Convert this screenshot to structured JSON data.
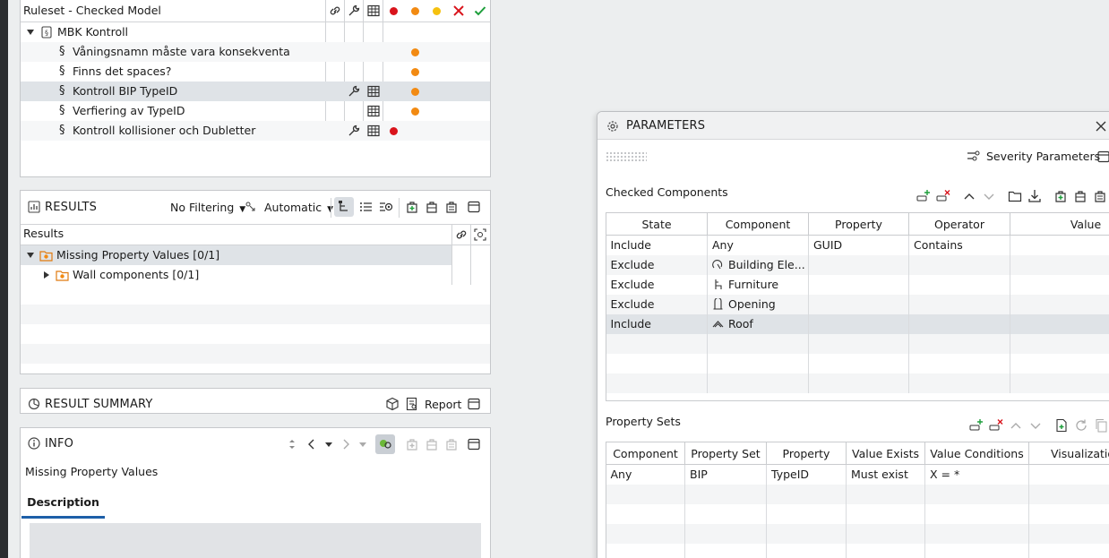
{
  "ruleset": {
    "title": "Ruleset - Checked Model",
    "root_label": "MBK Kontroll",
    "rules": [
      {
        "label": "Våningsnamn måste vara konsekventa",
        "wrench": false,
        "table": false,
        "dot": "orange"
      },
      {
        "label": "Finns det spaces?",
        "wrench": false,
        "table": false,
        "dot": "orange"
      },
      {
        "label": "Kontroll BIP TypeID",
        "wrench": true,
        "table": true,
        "dot": "orange"
      },
      {
        "label": "Verfiering av TypeID",
        "wrench": false,
        "table": true,
        "dot": "orange"
      },
      {
        "label": "Kontroll kollisioner och Dubletter",
        "wrench": true,
        "table": true,
        "dot": "red"
      }
    ]
  },
  "results": {
    "title": "RESULTS",
    "filter_label": "No Filtering",
    "mode_label": "Automatic",
    "column_header": "Results",
    "items": [
      {
        "label": "Missing Property Values [0/1]"
      },
      {
        "label": "Wall components [0/1]"
      }
    ]
  },
  "result_summary": {
    "title": "RESULT SUMMARY",
    "report_label": "Report"
  },
  "info": {
    "title": "INFO",
    "subject": "Missing Property Values",
    "tab_label": "Description"
  },
  "parameters": {
    "title": "PARAMETERS",
    "severity_label": "Severity Parameters",
    "checked_title": "Checked Components",
    "checked_headers": [
      "State",
      "Component",
      "Property",
      "Operator",
      "Value"
    ],
    "checked_rows": [
      {
        "state": "Include",
        "component": "Any",
        "icon": "",
        "property": "GUID",
        "operator": "Contains",
        "value": ""
      },
      {
        "state": "Exclude",
        "component": "Building Ele...",
        "icon": "building-element-icon",
        "property": "",
        "operator": "",
        "value": ""
      },
      {
        "state": "Exclude",
        "component": "Furniture",
        "icon": "furniture-icon",
        "property": "",
        "operator": "",
        "value": ""
      },
      {
        "state": "Exclude",
        "component": "Opening",
        "icon": "opening-icon",
        "property": "",
        "operator": "",
        "value": ""
      },
      {
        "state": "Include",
        "component": "Roof",
        "icon": "roof-icon",
        "property": "",
        "operator": "",
        "value": ""
      }
    ],
    "property_sets_title": "Property Sets",
    "ps_headers": [
      "Component",
      "Property Set",
      "Property",
      "Value Exists",
      "Value Conditions",
      "Visualization"
    ],
    "ps_rows": [
      {
        "component": "Any",
        "property_set": "BIP",
        "property": "TypeID",
        "value_exists": "Must exist",
        "value_conditions": "X = *",
        "visualization": ""
      }
    ]
  },
  "colors": {
    "orange": "#f28a12",
    "red": "#d9141c",
    "yellow": "#f5c10f",
    "green_check": "#1c9e3a",
    "selected_row": "#dfe3e7"
  }
}
